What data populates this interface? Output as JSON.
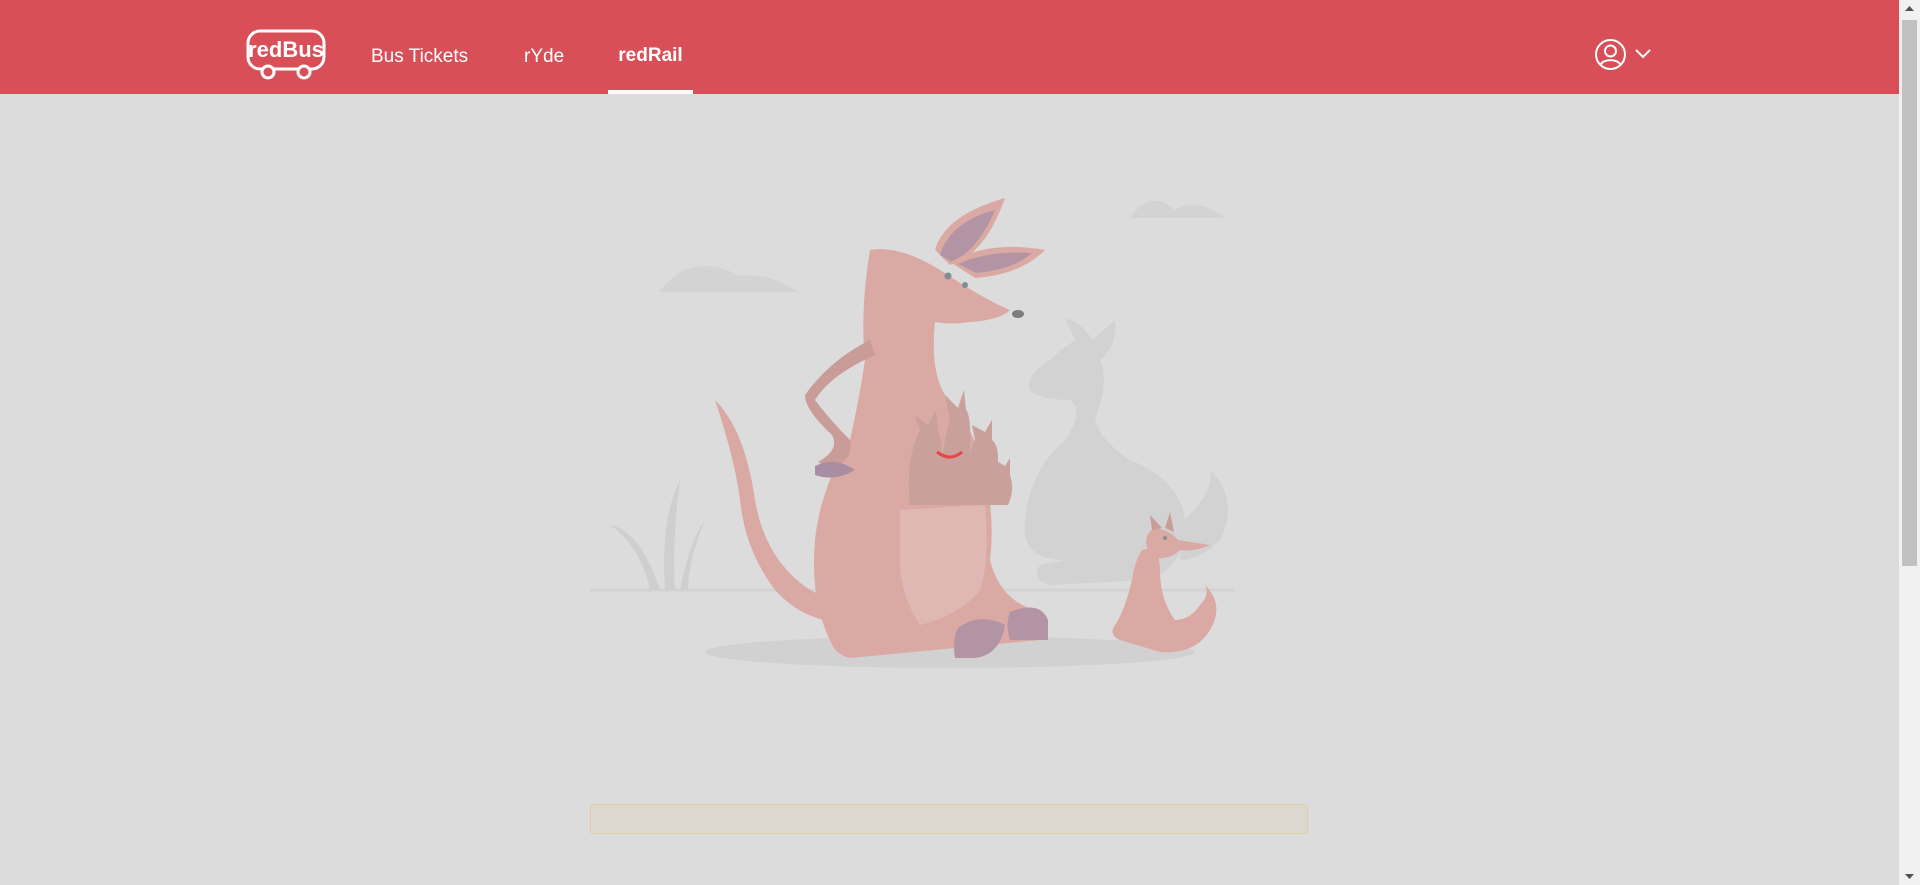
{
  "header": {
    "logo_text": "redBus",
    "nav": {
      "bus_tickets": "Bus Tickets",
      "ryde": "rYde",
      "redrail": "redRail"
    },
    "active_tab": "redRail",
    "profile_icon": "user-circle-icon",
    "dropdown_icon": "chevron-down-icon"
  },
  "colors": {
    "brand": "#d84f57",
    "background": "#dcdcdc",
    "nav_text": "#ffffff",
    "kangaroo": "#dba9a3",
    "kangaroo_ear": "#b394a5",
    "notice_border": "#e0cfa3"
  },
  "illustration": {
    "icon": "kangaroo-family-illustration"
  }
}
